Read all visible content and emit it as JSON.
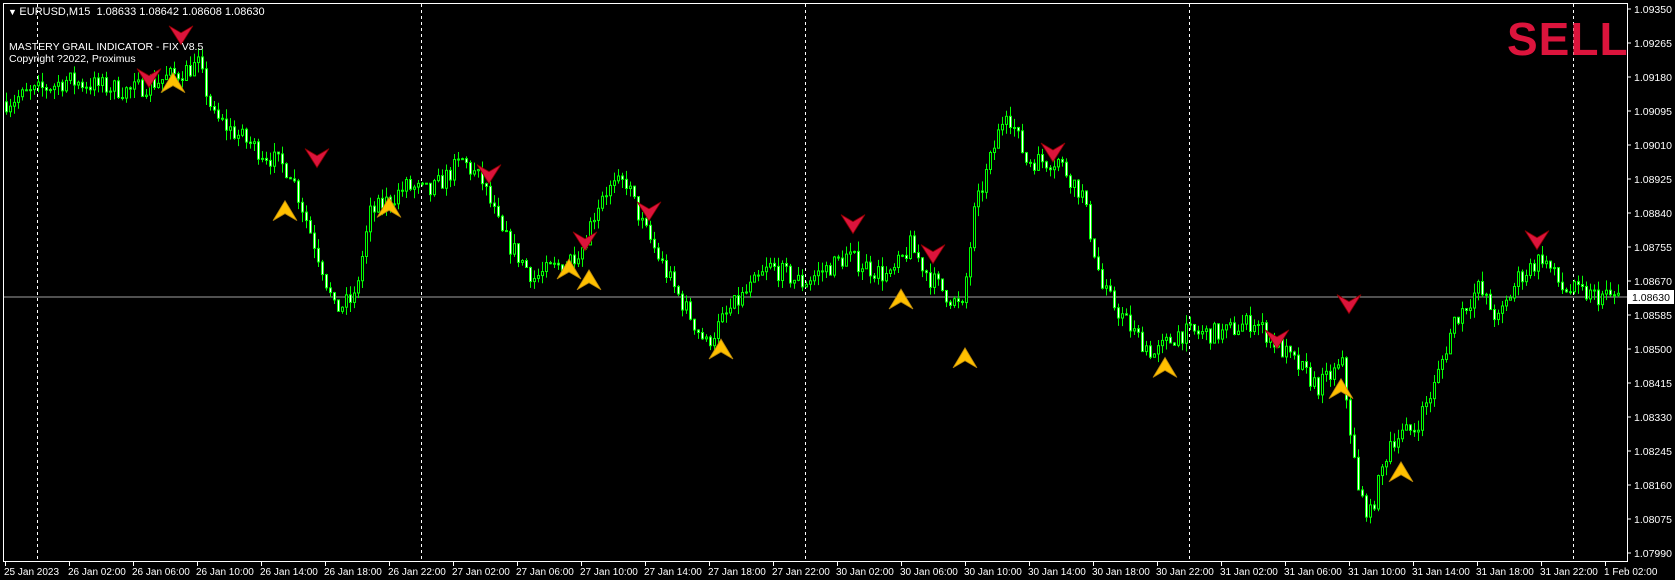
{
  "header": {
    "menu_icon": "triangle-down-icon",
    "symbol": "EURUSD,M15",
    "ohlc": "1.08633 1.08642 1.08608 1.08630"
  },
  "indicator": {
    "name": "MASTERY GRAIL INDICATOR - FIX V8.5",
    "copyright": "Copyright ?2022, Proximus"
  },
  "signal_label": "SELL",
  "colors": {
    "background": "#000000",
    "candle": "#00ff00",
    "bear_fill": "#ffffff",
    "sell": "#dc143c",
    "buy": "#ffc000",
    "sell_text": "#dc143c",
    "grid": "#ffffff"
  },
  "chart_data": {
    "type": "candlestick",
    "symbol": "EURUSD",
    "timeframe": "M15",
    "ylim": [
      1.0799,
      1.0935
    ],
    "y_ticks": [
      "1.09350",
      "1.09265",
      "1.09180",
      "1.09095",
      "1.09010",
      "1.08925",
      "1.08840",
      "1.08755",
      "1.08670",
      "1.08585",
      "1.08500",
      "1.08415",
      "1.08330",
      "1.08245",
      "1.08160",
      "1.08075",
      "1.07990"
    ],
    "current_price": "1.08630",
    "bar_count": 404,
    "x_ticks": [
      "25 Jan 2023",
      "26 Jan 02:00",
      "26 Jan 06:00",
      "26 Jan 10:00",
      "26 Jan 14:00",
      "26 Jan 18:00",
      "26 Jan 22:00",
      "27 Jan 02:00",
      "27 Jan 06:00",
      "27 Jan 10:00",
      "27 Jan 14:00",
      "27 Jan 18:00",
      "27 Jan 22:00",
      "30 Jan 02:00",
      "30 Jan 06:00",
      "30 Jan 10:00",
      "30 Jan 14:00",
      "30 Jan 18:00",
      "30 Jan 22:00",
      "31 Jan 02:00",
      "31 Jan 06:00",
      "31 Jan 10:00",
      "31 Jan 14:00",
      "31 Jan 18:00",
      "31 Jan 22:00",
      "1 Feb 02:00"
    ],
    "bars_per_x_tick": 16,
    "day_separators_bar": [
      8,
      104,
      200,
      296,
      392
    ],
    "close_path": [
      [
        0,
        1.09118
      ],
      [
        15,
        1.09171
      ],
      [
        31,
        1.09145
      ],
      [
        42,
        1.09185
      ],
      [
        48,
        1.09211
      ],
      [
        52,
        1.09078
      ],
      [
        63,
        1.08998
      ],
      [
        71,
        1.08945
      ],
      [
        79,
        1.08705
      ],
      [
        82,
        1.08598
      ],
      [
        87,
        1.08625
      ],
      [
        91,
        1.08838
      ],
      [
        100,
        1.08905
      ],
      [
        106,
        1.08891
      ],
      [
        114,
        1.08971
      ],
      [
        119,
        1.08918
      ],
      [
        124,
        1.08785
      ],
      [
        132,
        1.08678
      ],
      [
        140,
        1.08718
      ],
      [
        144,
        1.08758
      ],
      [
        149,
        1.08891
      ],
      [
        155,
        1.08918
      ],
      [
        159,
        1.08811
      ],
      [
        167,
        1.08651
      ],
      [
        175,
        1.08513
      ],
      [
        181,
        1.08598
      ],
      [
        191,
        1.08705
      ],
      [
        199,
        1.08665
      ],
      [
        210,
        1.08731
      ],
      [
        221,
        1.08678
      ],
      [
        226,
        1.08758
      ],
      [
        231,
        1.08678
      ],
      [
        239,
        1.08598
      ],
      [
        242,
        1.08838
      ],
      [
        250,
        1.09105
      ],
      [
        255,
        1.08971
      ],
      [
        263,
        1.08971
      ],
      [
        269,
        1.08886
      ],
      [
        274,
        1.08651
      ],
      [
        282,
        1.08539
      ],
      [
        287,
        1.08486
      ],
      [
        293,
        1.08539
      ],
      [
        304,
        1.08539
      ],
      [
        312,
        1.08571
      ],
      [
        320,
        1.08486
      ],
      [
        328,
        1.08406
      ],
      [
        334,
        1.08459
      ],
      [
        338,
        1.08139
      ],
      [
        341,
        1.08086
      ],
      [
        346,
        1.08273
      ],
      [
        352,
        1.083
      ],
      [
        357,
        1.08406
      ],
      [
        362,
        1.08571
      ],
      [
        368,
        1.08651
      ],
      [
        373,
        1.08571
      ],
      [
        378,
        1.08678
      ],
      [
        384,
        1.08731
      ],
      [
        389,
        1.08651
      ],
      [
        397,
        1.08633
      ],
      [
        403,
        1.0863
      ]
    ],
    "sell_signals": [
      [
        36,
        1.09171
      ],
      [
        44,
        1.09278
      ],
      [
        78,
        1.08971
      ],
      [
        121,
        1.08931
      ],
      [
        145,
        1.08763
      ],
      [
        161,
        1.08838
      ],
      [
        212,
        1.08806
      ],
      [
        232,
        1.08731
      ],
      [
        262,
        1.08985
      ],
      [
        318,
        1.08518
      ],
      [
        336,
        1.08606
      ],
      [
        383,
        1.08766
      ]
    ],
    "buy_signals": [
      [
        42,
        1.09171
      ],
      [
        70,
        1.08851
      ],
      [
        96,
        1.08859
      ],
      [
        141,
        1.08705
      ],
      [
        146,
        1.08678
      ],
      [
        179,
        1.08505
      ],
      [
        224,
        1.0863
      ],
      [
        240,
        1.08483
      ],
      [
        290,
        1.08459
      ],
      [
        334,
        1.08406
      ],
      [
        349,
        1.08198
      ]
    ]
  }
}
